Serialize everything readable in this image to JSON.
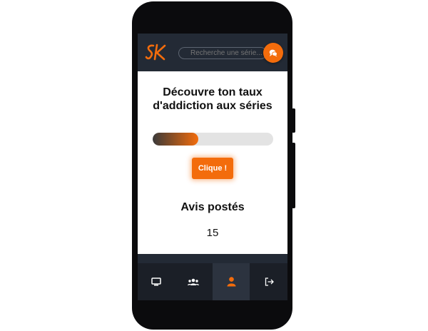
{
  "colors": {
    "accent": "#f36c0c",
    "topbar": "#232a35",
    "navbar": "#1b1f27",
    "active_tab": "#2c333f"
  },
  "header": {
    "logo_text": "SK",
    "search_placeholder": "Recherche une série...",
    "chat_icon": "chat-bubbles-icon"
  },
  "main": {
    "title_line1": "Découvre ton taux",
    "title_line2": "d'addiction aux séries",
    "progress": 0.38,
    "button_label": "Clique !",
    "reviews_title": "Avis postés",
    "reviews_count": "15"
  },
  "bottom_nav": [
    {
      "icon": "tv-monitor-icon",
      "active": false
    },
    {
      "icon": "users-group-icon",
      "active": false
    },
    {
      "icon": "user-profile-icon",
      "active": true
    },
    {
      "icon": "logout-icon",
      "active": false
    }
  ]
}
